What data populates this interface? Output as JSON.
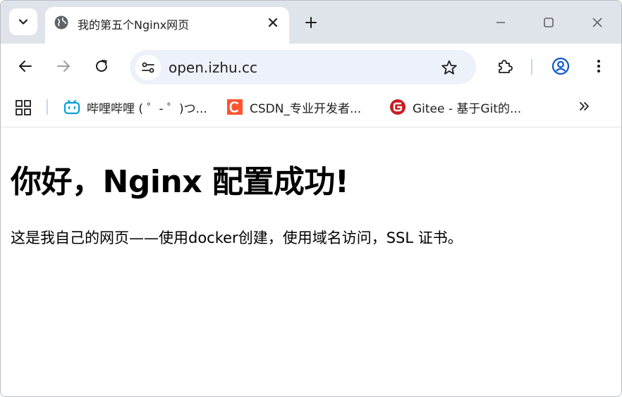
{
  "browser": {
    "tab": {
      "title": "我的第五个Nginx网页"
    },
    "address_bar": {
      "url": "open.izhu.cc"
    },
    "bookmarks": [
      {
        "label": "哔哩哔哩 ( ゜- ゜)つ...",
        "icon": "bilibili-icon"
      },
      {
        "label": "CSDN_专业开发者...",
        "icon": "csdn-icon"
      },
      {
        "label": "Gitee - 基于Git的...",
        "icon": "gitee-icon"
      }
    ]
  },
  "page": {
    "heading": "你好，Nginx 配置成功!",
    "paragraph": "这是我自己的网页——使用docker创建，使用域名访问，SSL 证书。"
  },
  "colors": {
    "tabstrip": "#dfe3ea",
    "omnibox": "#edf2fa",
    "profile_accent": "#0b57d0",
    "csdn": "#fc5531",
    "gitee": "#c71d23",
    "bilibili": "#00a1d6"
  }
}
